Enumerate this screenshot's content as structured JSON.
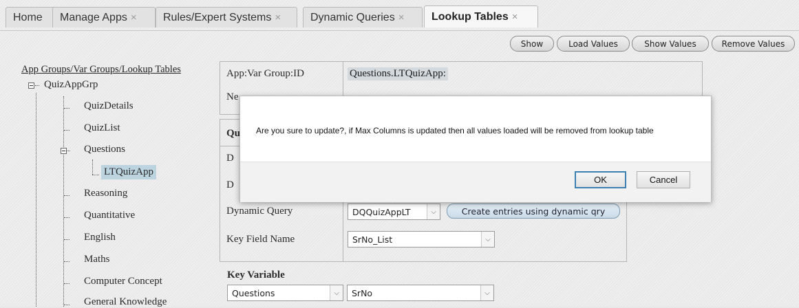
{
  "tabs": [
    {
      "label": "Home",
      "closable": false
    },
    {
      "label": "Manage Apps",
      "closable": true
    },
    {
      "label": "Rules/Expert Systems",
      "closable": true
    },
    {
      "label": "Dynamic Queries",
      "closable": true
    },
    {
      "label": "Lookup Tables",
      "closable": true,
      "active": true
    }
  ],
  "close_glyph": "×",
  "toolbar": {
    "show_label": "Show",
    "load_values_label": "Load Values",
    "show_values_label": "Show Values",
    "remove_values_label": "Remove Values"
  },
  "tree": {
    "title": "App Groups/Var Groups/Lookup Tables",
    "root": "QuizAppGrp",
    "items": [
      "QuizDetails",
      "QuizList",
      "Questions",
      "LTQuizApp",
      "Reasoning",
      "Quantitative",
      "English",
      "Maths",
      "Computer Concept",
      "General Knowledge"
    ]
  },
  "form": {
    "app_var_group_label": "App:Var Group:ID",
    "app_var_group_value": "Questions.LTQuizApp:",
    "new_label_partial": "Ne",
    "section_partial": "Qu",
    "row_partial_1": "D",
    "row_partial_2": "D",
    "dynamic_query_label": "Dynamic Query",
    "dynamic_query_value": "DQQuizAppLT",
    "create_entries_label": "Create entries using dynamic qry",
    "key_field_label": "Key Field Name",
    "key_field_value": "SrNo_List",
    "key_variable_heading": "Key Variable",
    "key_variable_group": "Questions",
    "key_variable_name": "SrNo"
  },
  "modal": {
    "message": "Are you sure to update?, if Max Columns is updated then all values loaded will be removed from lookup table",
    "ok_label": "OK",
    "cancel_label": "Cancel"
  },
  "icons": {
    "dropdown": "chevron-down-icon",
    "tree_expand": "minus-box-icon"
  },
  "colors": {
    "accent": "#3c7fb1",
    "selection": "#bcd3e0"
  }
}
